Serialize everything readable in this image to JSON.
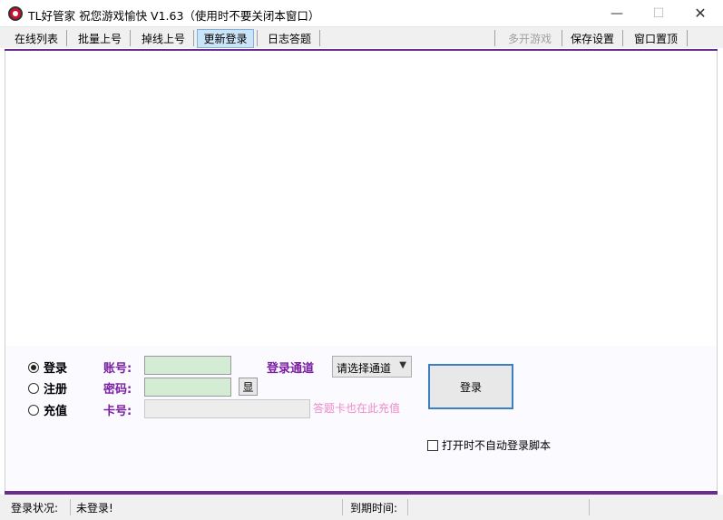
{
  "window": {
    "title": "TL好管家 祝您游戏愉快 V1.63（使用时不要关闭本窗口）",
    "controls": {
      "minimize": "—",
      "maximize": "☐",
      "close": "✕"
    }
  },
  "toolbar": {
    "online_list": "在线列表",
    "batch_login": "批量上号",
    "offline_login": "掉线上号",
    "update_login": "更新登录",
    "daily_quiz": "日志答题",
    "multi_open": "多开游戏",
    "save_settings": "保存设置",
    "window_top": "窗口置顶"
  },
  "form": {
    "radios": [
      {
        "label": "登录",
        "selected": true
      },
      {
        "label": "注册",
        "selected": false
      },
      {
        "label": "充值",
        "selected": false
      }
    ],
    "account_label": "账号:",
    "password_label": "密码:",
    "card_label": "卡号:",
    "account_value": "",
    "password_value": "",
    "card_value": "",
    "show_button": "显",
    "card_hint": "答题卡也在此充值",
    "channel_label": "登录通道",
    "channel_select": "请选择通道",
    "login_button": "登录",
    "auto_script_checkbox": "打开时不自动登录脚本"
  },
  "status": {
    "login_status_label": "登录状况:",
    "login_status_value": "未登录!",
    "expiry_label": "到期时间:",
    "expiry_value": ""
  },
  "colors": {
    "accent": "#6a2c91",
    "label": "#7b1fa2",
    "hint": "#f08ac8",
    "input_bg": "#d4ecd4"
  }
}
